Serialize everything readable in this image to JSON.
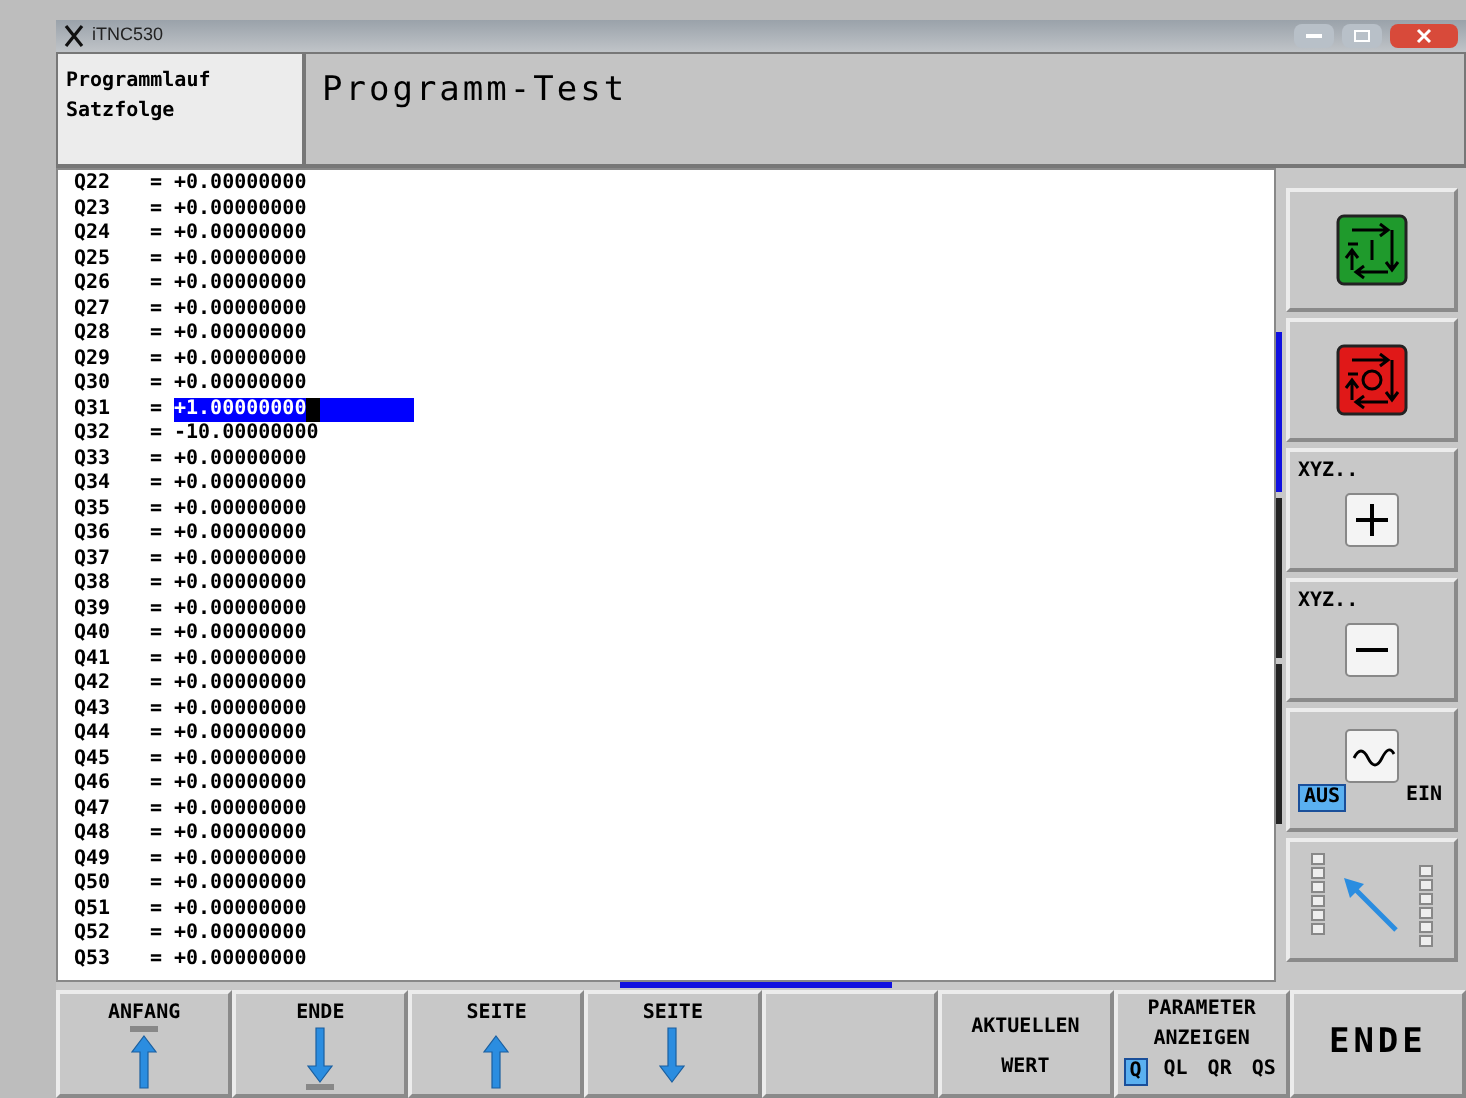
{
  "window": {
    "title": "iTNC530"
  },
  "header": {
    "mode_lines": [
      "Programmlauf",
      "Satzfolge"
    ],
    "title": "Programm-Test"
  },
  "parameters": [
    {
      "name": "Q22",
      "sign": "=",
      "value": "+0.00000000",
      "selected": false
    },
    {
      "name": "Q23",
      "sign": "=",
      "value": "+0.00000000",
      "selected": false
    },
    {
      "name": "Q24",
      "sign": "=",
      "value": "+0.00000000",
      "selected": false
    },
    {
      "name": "Q25",
      "sign": "=",
      "value": "+0.00000000",
      "selected": false
    },
    {
      "name": "Q26",
      "sign": "=",
      "value": "+0.00000000",
      "selected": false
    },
    {
      "name": "Q27",
      "sign": "=",
      "value": "+0.00000000",
      "selected": false
    },
    {
      "name": "Q28",
      "sign": "=",
      "value": "+0.00000000",
      "selected": false
    },
    {
      "name": "Q29",
      "sign": "=",
      "value": "+0.00000000",
      "selected": false
    },
    {
      "name": "Q30",
      "sign": "=",
      "value": "+0.00000000",
      "selected": false
    },
    {
      "name": "Q31",
      "sign": "=",
      "value": "+1.00000000",
      "selected": true
    },
    {
      "name": "Q32",
      "sign": "=",
      "value": "-10.00000000",
      "selected": false
    },
    {
      "name": "Q33",
      "sign": "=",
      "value": "+0.00000000",
      "selected": false
    },
    {
      "name": "Q34",
      "sign": "=",
      "value": "+0.00000000",
      "selected": false
    },
    {
      "name": "Q35",
      "sign": "=",
      "value": "+0.00000000",
      "selected": false
    },
    {
      "name": "Q36",
      "sign": "=",
      "value": "+0.00000000",
      "selected": false
    },
    {
      "name": "Q37",
      "sign": "=",
      "value": "+0.00000000",
      "selected": false
    },
    {
      "name": "Q38",
      "sign": "=",
      "value": "+0.00000000",
      "selected": false
    },
    {
      "name": "Q39",
      "sign": "=",
      "value": "+0.00000000",
      "selected": false
    },
    {
      "name": "Q40",
      "sign": "=",
      "value": "+0.00000000",
      "selected": false
    },
    {
      "name": "Q41",
      "sign": "=",
      "value": "+0.00000000",
      "selected": false
    },
    {
      "name": "Q42",
      "sign": "=",
      "value": "+0.00000000",
      "selected": false
    },
    {
      "name": "Q43",
      "sign": "=",
      "value": "+0.00000000",
      "selected": false
    },
    {
      "name": "Q44",
      "sign": "=",
      "value": "+0.00000000",
      "selected": false
    },
    {
      "name": "Q45",
      "sign": "=",
      "value": "+0.00000000",
      "selected": false
    },
    {
      "name": "Q46",
      "sign": "=",
      "value": "+0.00000000",
      "selected": false
    },
    {
      "name": "Q47",
      "sign": "=",
      "value": "+0.00000000",
      "selected": false
    },
    {
      "name": "Q48",
      "sign": "=",
      "value": "+0.00000000",
      "selected": false
    },
    {
      "name": "Q49",
      "sign": "=",
      "value": "+0.00000000",
      "selected": false
    },
    {
      "name": "Q50",
      "sign": "=",
      "value": "+0.00000000",
      "selected": false
    },
    {
      "name": "Q51",
      "sign": "=",
      "value": "+0.00000000",
      "selected": false
    },
    {
      "name": "Q52",
      "sign": "=",
      "value": "+0.00000000",
      "selected": false
    },
    {
      "name": "Q53",
      "sign": "=",
      "value": "+0.00000000",
      "selected": false
    }
  ],
  "side_softkeys": [
    {
      "kind": "green"
    },
    {
      "kind": "red"
    },
    {
      "kind": "plus",
      "label": "XYZ.."
    },
    {
      "kind": "minus",
      "label": "XYZ.."
    },
    {
      "kind": "toggle",
      "options": [
        {
          "label": "AUS",
          "selected": true
        },
        {
          "label": "EIN",
          "selected": false
        }
      ]
    },
    {
      "kind": "arrow"
    }
  ],
  "bottom_softkeys": [
    {
      "kind": "top",
      "label": "ANFANG"
    },
    {
      "kind": "bottom",
      "label": "ENDE"
    },
    {
      "kind": "up",
      "label": "SEITE"
    },
    {
      "kind": "down",
      "label": "SEITE"
    },
    {
      "kind": "empty"
    },
    {
      "kind": "text",
      "lines": [
        "AKTUELLEN",
        "WERT"
      ]
    },
    {
      "kind": "params",
      "lines": [
        "PARAMETER",
        "ANZEIGEN"
      ],
      "options": [
        {
          "label": "Q",
          "selected": true
        },
        {
          "label": "QL",
          "selected": false
        },
        {
          "label": "QR",
          "selected": false
        },
        {
          "label": "QS",
          "selected": false
        }
      ]
    },
    {
      "kind": "big",
      "label": "ENDE"
    }
  ]
}
